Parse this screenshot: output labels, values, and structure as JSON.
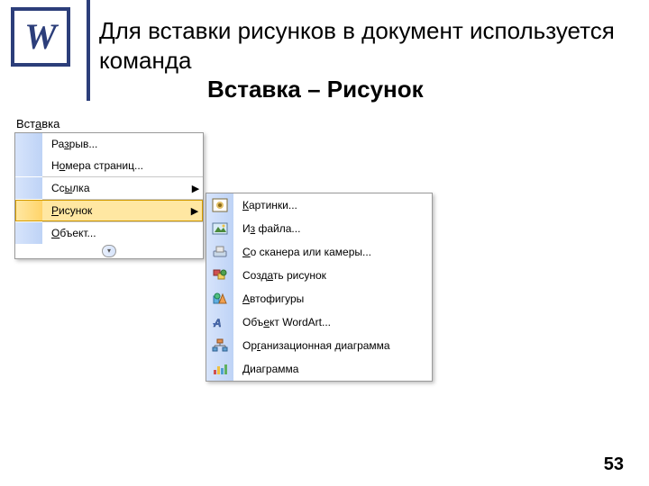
{
  "logo_letter": "W",
  "heading": {
    "line1": "Для вставки рисунков в документ используется команда",
    "line2": "Вставка – Рисунок"
  },
  "menu_title_parts": {
    "pre": "Вст",
    "u": "а",
    "post": "вка"
  },
  "menu_items": {
    "razryv": {
      "pre": "Ра",
      "u": "з",
      "post": "рыв..."
    },
    "nomera": {
      "pre": "Н",
      "u": "о",
      "post": "мера страниц..."
    },
    "ssylka": {
      "pre": "Сс",
      "u": "ы",
      "post": "лка"
    },
    "risunok": {
      "pre": "",
      "u": "Р",
      "post": "исунок"
    },
    "objekt": {
      "pre": "",
      "u": "О",
      "post": "бъект..."
    }
  },
  "submenu_items": {
    "kartinki": {
      "pre": "",
      "u": "К",
      "post": "артинки..."
    },
    "izfaila": {
      "pre": "И",
      "u": "з",
      "post": " файла..."
    },
    "scanner": {
      "pre": "",
      "u": "С",
      "post": "о сканера или камеры..."
    },
    "sozdat": {
      "pre": "Созд",
      "u": "а",
      "post": "ть рисунок"
    },
    "avtofig": {
      "pre": "",
      "u": "А",
      "post": "втофигуры"
    },
    "wordart": {
      "pre": "Объ",
      "u": "е",
      "post": "кт WordArt..."
    },
    "orgdiag": {
      "pre": "Ор",
      "u": "г",
      "post": "анизационная диаграмма"
    },
    "diagramma": {
      "pre": "",
      "u": "Д",
      "post": "иаграмма"
    }
  },
  "page_number": "53"
}
